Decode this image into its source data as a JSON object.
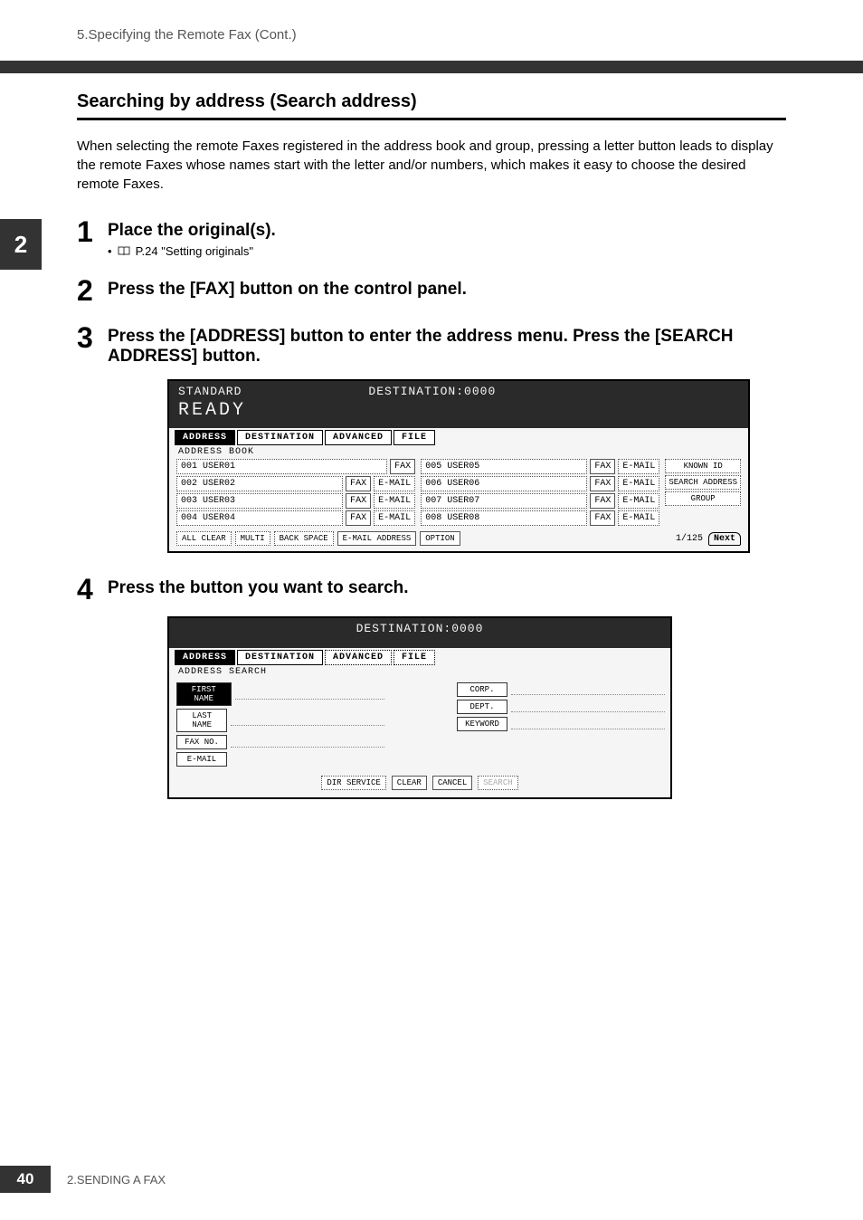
{
  "header": {
    "breadcrumb": "5.Specifying the Remote Fax (Cont.)"
  },
  "sideTab": "2",
  "section": {
    "title": "Searching by address (Search address)",
    "intro": "When selecting the remote Faxes registered in the address book and group, pressing a letter button leads to display the remote Faxes whose names start with the letter and/or numbers, which makes it easy to choose the desired remote Faxes."
  },
  "steps": [
    {
      "num": "1",
      "title": "Place the original(s).",
      "sub": "P.24 \"Setting originals\""
    },
    {
      "num": "2",
      "title": "Press the [FAX] button on the control panel."
    },
    {
      "num": "3",
      "title": "Press the [ADDRESS] button to enter the address menu. Press the [SEARCH ADDRESS] button."
    },
    {
      "num": "4",
      "title": "Press the button you want to search."
    }
  ],
  "sc1": {
    "standard": "STANDARD",
    "dest": "DESTINATION:0000",
    "ready": "READY",
    "tabs": [
      "ADDRESS",
      "DESTINATION",
      "ADVANCED",
      "FILE"
    ],
    "subLabel": "ADDRESS BOOK",
    "rowsLeft": [
      {
        "name": "001 USER01",
        "b": [
          "FAX"
        ]
      },
      {
        "name": "002 USER02",
        "b": [
          "FAX",
          "E-MAIL"
        ]
      },
      {
        "name": "003 USER03",
        "b": [
          "FAX",
          "E-MAIL"
        ]
      },
      {
        "name": "004 USER04",
        "b": [
          "FAX",
          "E-MAIL"
        ]
      }
    ],
    "rowsRight": [
      {
        "name": "005 USER05",
        "b": [
          "FAX",
          "E-MAIL"
        ]
      },
      {
        "name": "006 USER06",
        "b": [
          "FAX",
          "E-MAIL"
        ]
      },
      {
        "name": "007 USER07",
        "b": [
          "FAX",
          "E-MAIL"
        ]
      },
      {
        "name": "008 USER08",
        "b": [
          "FAX",
          "E-MAIL"
        ]
      }
    ],
    "sideButtons": [
      "KNOWN ID",
      "SEARCH ADDRESS",
      "GROUP"
    ],
    "bottom": [
      "ALL CLEAR",
      "MULTI",
      "BACK SPACE",
      "E-MAIL ADDRESS",
      "OPTION"
    ],
    "page": "1/125",
    "next": "Next"
  },
  "sc2": {
    "dest": "DESTINATION:0000",
    "tabs": [
      "ADDRESS",
      "DESTINATION",
      "ADVANCED",
      "FILE"
    ],
    "subLabel": "ADDRESS SEARCH",
    "left": [
      "FIRST NAME",
      "LAST NAME",
      "FAX NO.",
      "E-MAIL"
    ],
    "right": [
      "CORP.",
      "DEPT.",
      "KEYWORD"
    ],
    "bottom": [
      "DIR SERVICE",
      "CLEAR",
      "CANCEL",
      "SEARCH"
    ]
  },
  "footer": {
    "page": "40",
    "chapter": "2.SENDING A FAX"
  }
}
